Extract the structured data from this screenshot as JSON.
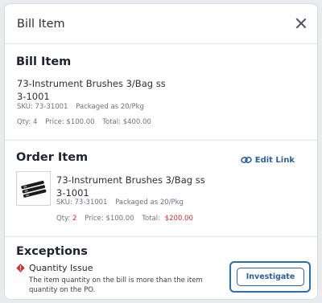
{
  "header": {
    "title": "Bill Item"
  },
  "bill_item": {
    "heading": "Bill Item",
    "name_line1": "73-Instrument Brushes 3/Bag ss",
    "name_line2": "3-1001",
    "sku": "SKU: 73-31001",
    "packaged": "Packaged as 20/Pkg",
    "qty": "Qty: 4",
    "price": "Price: $100.00",
    "total": "Total: $400.00"
  },
  "order_item": {
    "heading": "Order Item",
    "edit_link": "Edit Link",
    "name_line1": "73-Instrument Brushes 3/Bag ss",
    "name_line2": "3-1001",
    "sku": "SKU: 73-31001",
    "packaged": "Packaged as 20/Pkg",
    "qty_label": "Qty:",
    "qty_value": "2",
    "price": "Price: $100.00",
    "total_label": "Total:",
    "total_value": "$200.00"
  },
  "exceptions": {
    "heading": "Exceptions",
    "issue_title": "Quantity Issue",
    "issue_description": "The item quantity on the bill is more than the item quantity on the PO.",
    "action_button": "Investigate"
  },
  "icons": {
    "close": "close-icon",
    "edit_link": "link-icon",
    "warning": "warning-diamond-icon",
    "product": "product-thumbnail"
  },
  "colors": {
    "accent": "#2f5f9a",
    "warning": "#c62f2f",
    "focus": "#2a6db0"
  }
}
